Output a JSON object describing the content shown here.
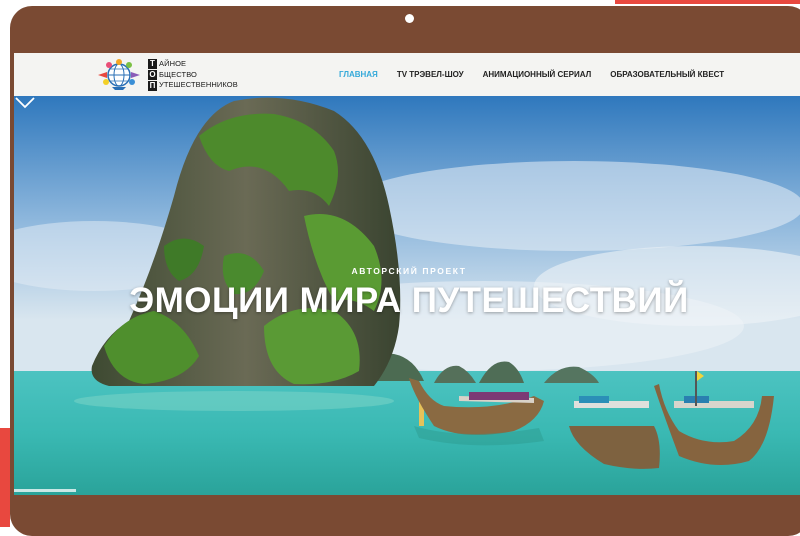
{
  "colors": {
    "frame": "#7a4a33",
    "accent_red": "#e8483f",
    "nav_active": "#35a9d9",
    "nav_text": "#222222",
    "nav_bg": "#f4f4f2"
  },
  "logo": {
    "letters": [
      "Т",
      "О",
      "П"
    ],
    "words": [
      "АЙНОЕ",
      "БЩЕСТВО",
      "УТЕШЕСТВЕННИКОВ"
    ],
    "icon": "globe-ships-icon"
  },
  "nav": {
    "items": [
      {
        "label": "ГЛАВНАЯ",
        "active": true
      },
      {
        "label": "TV ТРЭВЕЛ-ШОУ",
        "active": false
      },
      {
        "label": "АНИМАЦИОННЫЙ СЕРИАЛ",
        "active": false
      },
      {
        "label": "ОБРАЗОВАТЕЛЬНЫЙ КВЕСТ",
        "active": false
      }
    ]
  },
  "hero": {
    "eyebrow": "АВТОРСКИЙ ПРОЕКТ",
    "title": "ЭМОЦИИ МИРА ПУТЕШЕСТВИЙ",
    "scroll_icon": "chevron-down-icon",
    "image": "tropical-island-longtail-boats"
  }
}
